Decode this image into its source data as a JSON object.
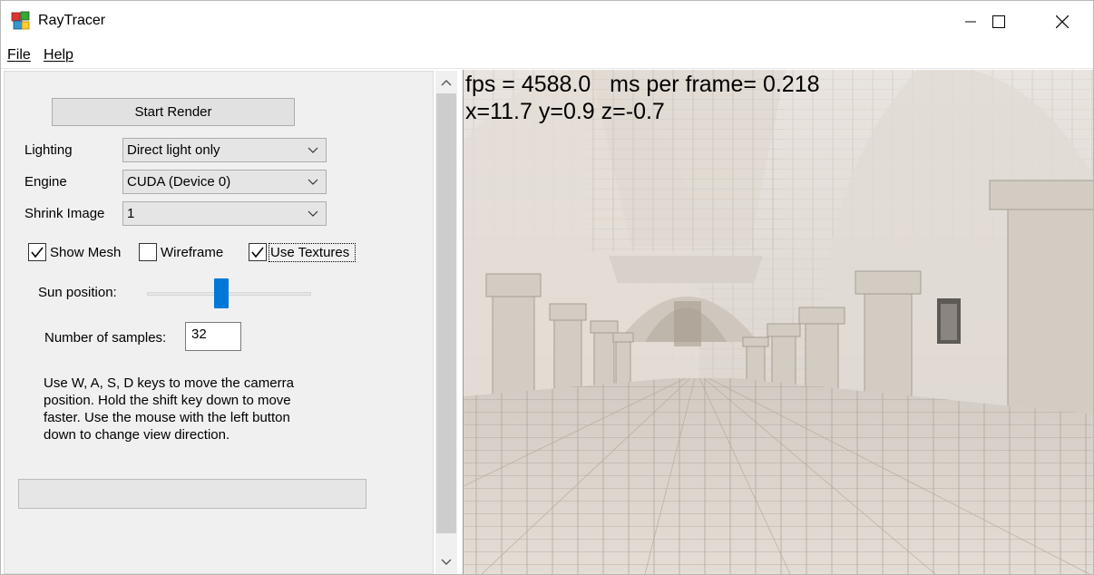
{
  "window": {
    "title": "RayTracer",
    "controls": {
      "minimize": "─",
      "maximize": "☐",
      "close": "✕"
    }
  },
  "menu": {
    "file": {
      "mnemonic": "F",
      "rest": "ile"
    },
    "help": {
      "mnemonic": "H",
      "rest": "elp"
    }
  },
  "panel": {
    "start_render_label": "Start Render",
    "lighting": {
      "label": "Lighting",
      "value": "Direct light only"
    },
    "engine": {
      "label": "Engine",
      "value": "CUDA (Device 0)"
    },
    "shrink": {
      "label": "Shrink Image",
      "value": "1"
    },
    "show_mesh": {
      "label": "Show Mesh",
      "checked": true
    },
    "wireframe": {
      "label": "Wireframe",
      "checked": false
    },
    "use_textures": {
      "label": "Use Textures",
      "checked": true
    },
    "sun_position": {
      "label": "Sun position:",
      "level_fraction": 0.45
    },
    "samples": {
      "label": "Number of samples:",
      "value": "32"
    },
    "help_text": "Use W, A, S, D keys to move the camerra position. Hold the shift key down to move faster. Use the mouse with the left button down to change view direction.",
    "progress_fraction": 0
  },
  "viewport": {
    "stats_line": "fps = 4588.0   ms per frame= 0.218",
    "position_line": "x=11.7 y=0.9 z=-0.7"
  },
  "colors": {
    "accent": "#0078d7",
    "panel_bg": "#f0f0f0",
    "stone_light": "#e8e2dc",
    "stone_shadow": "#b9b1a8"
  },
  "icons": {
    "app": "raytracer-app-icon",
    "dropdown": "chevron-down-icon",
    "checkbox": "check-icon",
    "scroll_up": "chevron-up-icon",
    "scroll_down": "chevron-down-icon"
  }
}
